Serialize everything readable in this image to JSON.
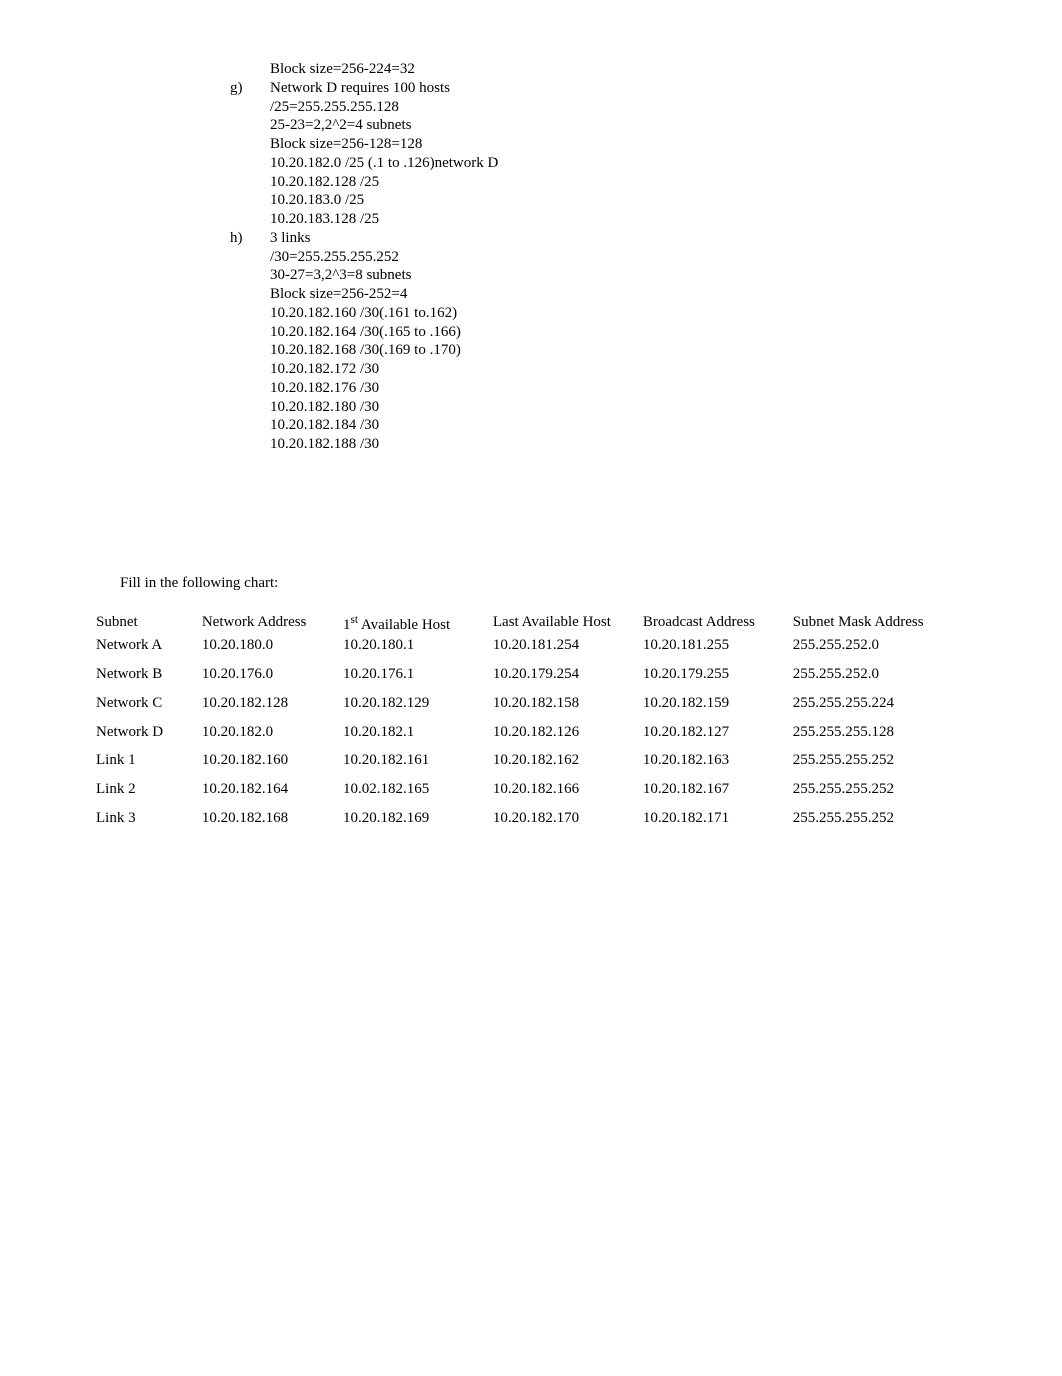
{
  "upper": {
    "pre_g": [
      "Block size=256-224=32"
    ],
    "g_label": "g)",
    "g_lines": [
      "Network D requires 100 hosts",
      "/25=255.255.255.128",
      "25-23=2,2^2=4 subnets",
      "Block size=256-128=128",
      "10.20.182.0 /25 (.1 to .126)network D",
      "10.20.182.128 /25",
      "10.20.183.0 /25",
      "10.20.183.128 /25"
    ],
    "h_label": "h)",
    "h_lines": [
      "3 links",
      "/30=255.255.255.252",
      "30-27=3,2^3=8 subnets",
      "Block size=256-252=4",
      "10.20.182.160 /30(.161 to.162)",
      "10.20.182.164 /30(.165 to .166)",
      "10.20.182.168 /30(.169 to .170)",
      "10.20.182.172 /30",
      "10.20.182.176 /30",
      "10.20.182.180 /30",
      "10.20.182.184 /30",
      "10.20.182.188 /30"
    ]
  },
  "chart_heading": "Fill in the following chart:",
  "chart_data": {
    "type": "table",
    "columns": [
      "Subnet",
      "Network Address",
      "1st Available Host",
      "Last Available Host",
      "Broadcast Address",
      "Subnet Mask Address"
    ],
    "rows": [
      {
        "subnet": "Network A",
        "network": "10.20.180.0",
        "first": "10.20.180.1",
        "last": "10.20.181.254",
        "broadcast": "10.20.181.255",
        "mask": "255.255.252.0"
      },
      {
        "subnet": "Network B",
        "network": "10.20.176.0",
        "first": "10.20.176.1",
        "last": "10.20.179.254",
        "broadcast": "10.20.179.255",
        "mask": "255.255.252.0"
      },
      {
        "subnet": "Network C",
        "network": "10.20.182.128",
        "first": "10.20.182.129",
        "last": "10.20.182.158",
        "broadcast": "10.20.182.159",
        "mask": "255.255.255.224"
      },
      {
        "subnet": "Network D",
        "network": "10.20.182.0",
        "first": "10.20.182.1",
        "last": "10.20.182.126",
        "broadcast": "10.20.182.127",
        "mask": "255.255.255.128"
      },
      {
        "subnet": "Link 1",
        "network": "10.20.182.160",
        "first": "10.20.182.161",
        "last": "10.20.182.162",
        "broadcast": "10.20.182.163",
        "mask": "255.255.255.252"
      },
      {
        "subnet": "Link 2",
        "network": "10.20.182.164",
        "first": "10.02.182.165",
        "last": "10.20.182.166",
        "broadcast": "10.20.182.167",
        "mask": "255.255.255.252"
      },
      {
        "subnet": "Link 3",
        "network": "10.20.182.168",
        "first": "10.20.182.169",
        "last": "10.20.182.170",
        "broadcast": "10.20.182.171",
        "mask": "255.255.255.252"
      }
    ]
  }
}
